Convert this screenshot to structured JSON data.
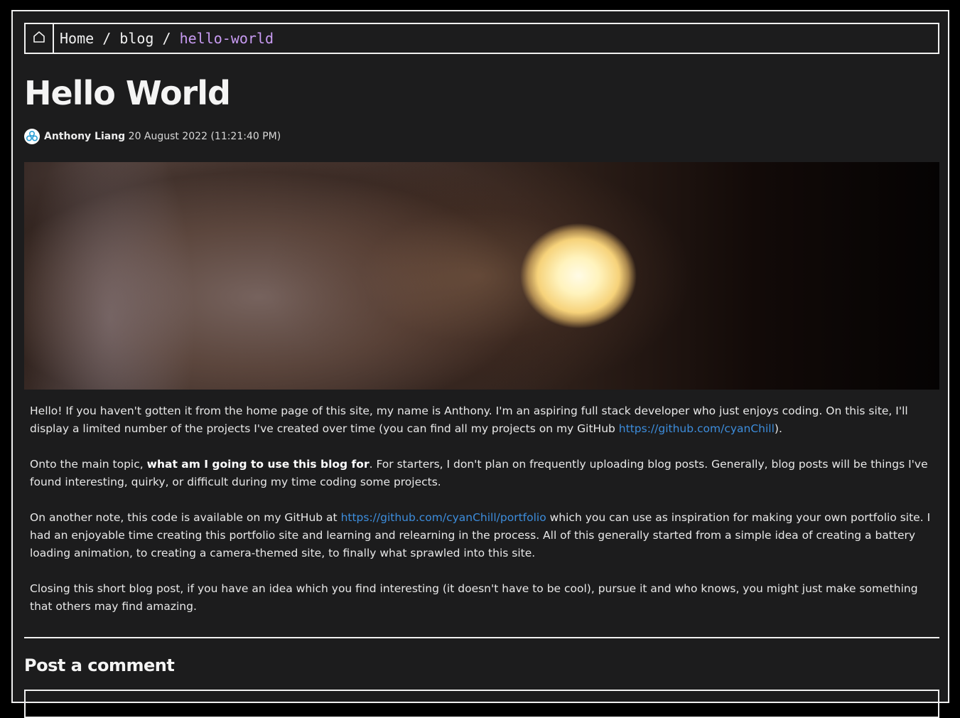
{
  "breadcrumb": {
    "home_icon": "house-icon",
    "items": [
      "Home",
      "blog"
    ],
    "separator": " / ",
    "current": "hello-world"
  },
  "post": {
    "title": "Hello World",
    "author": "Anthony Liang",
    "date": "20 August 2022 (11:21:40 PM)",
    "avatar_icon": "avatar-logo-icon",
    "hero_image": "blurred-light-orb-image"
  },
  "body": {
    "p1": {
      "text": "Hello! If you haven't gotten it from the home page of this site, my name is Anthony. I'm an aspiring full stack developer who just enjoys coding. On this site, I'll display a limited number of the projects I've created over time (you can find all my projects on my GitHub ",
      "link": "https://github.com/cyanChill",
      "after": ")."
    },
    "p2": {
      "before": "Onto the main topic, ",
      "bold": "what am I going to use this blog for",
      "after": ". For starters, I don't plan on frequently uploading blog posts. Generally, blog posts will be things I've found interesting, quirky, or difficult during my time coding some projects."
    },
    "p3": {
      "before": "On another note, this code is available on my GitHub at ",
      "link": "https://github.com/cyanChill/portfolio",
      "after": " which you can use as inspiration for making your own portfolio site. I had an enjoyable time creating this portfolio site and learning and relearning in the process. All of this generally started from a simple idea of creating a battery loading animation, to creating a camera-themed site, to finally what sprawled into this site."
    },
    "p4": {
      "text": "Closing this short blog post, if you have an idea which you find interesting (it doesn't have to be cool), pursue it and who knows, you might just make something that others may find amazing."
    }
  },
  "comments": {
    "heading": "Post a comment"
  },
  "colors": {
    "background": "#1c1c1d",
    "border": "#f0f0f0",
    "link": "#3d8ddc",
    "current_crumb": "#c89bf2"
  }
}
